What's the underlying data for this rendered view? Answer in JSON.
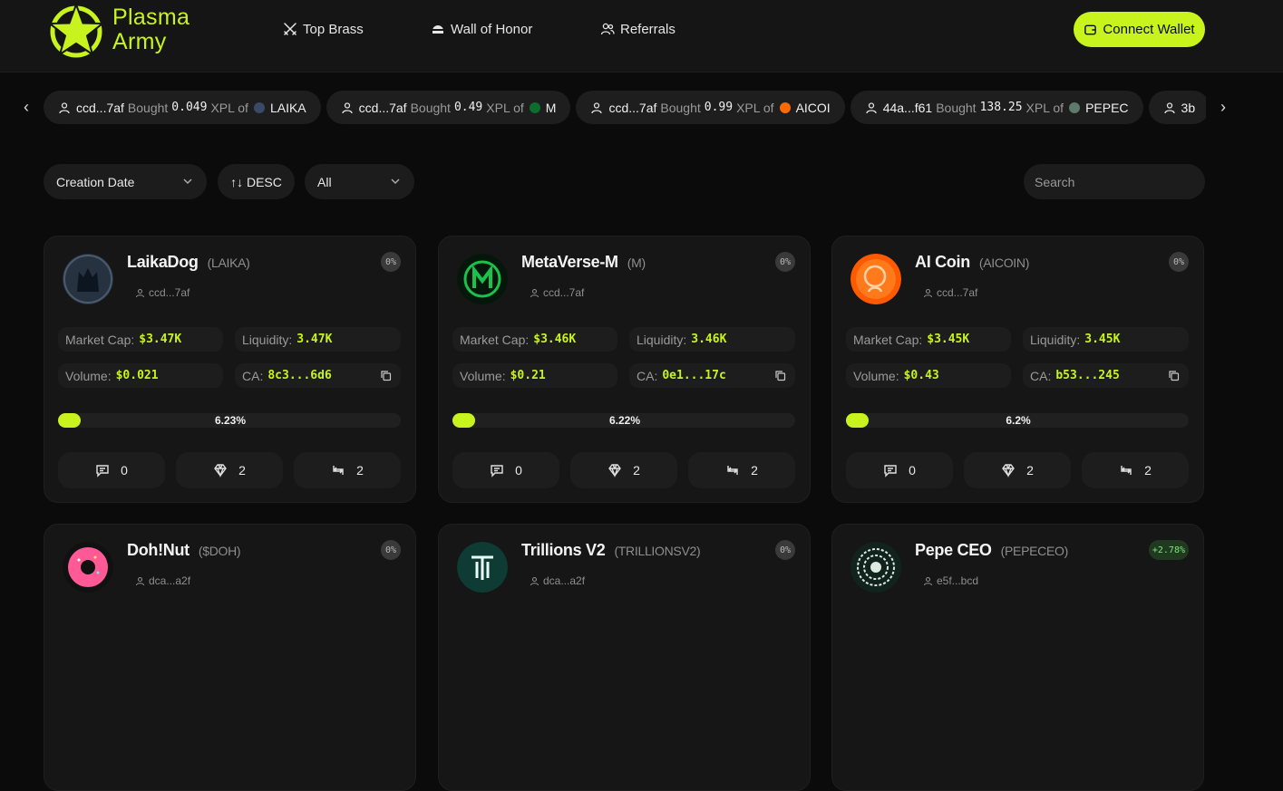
{
  "brand": {
    "line1": "Plasma",
    "line2": "Army",
    "accent": "#c8f31d"
  },
  "nav": [
    {
      "label": "Top Brass",
      "icon": "crossed-swords-icon"
    },
    {
      "label": "Wall of Honor",
      "icon": "helmet-icon"
    },
    {
      "label": "Referrals",
      "icon": "users-icon"
    }
  ],
  "connect_label": "Connect Wallet",
  "ticker": [
    {
      "address": "ccd...7af",
      "verb": "Bought",
      "amount": "0.049",
      "unit": "XPL of",
      "token": "LAIKA",
      "coin_color": "#3a4a66"
    },
    {
      "address": "ccd...7af",
      "verb": "Bought",
      "amount": "0.49",
      "unit": "XPL of",
      "token": "M",
      "coin_color": "#0c6e2c"
    },
    {
      "address": "ccd...7af",
      "verb": "Bought",
      "amount": "0.99",
      "unit": "XPL of",
      "token": "AICOI",
      "coin_color": "#ff6a00"
    },
    {
      "address": "44a...f61",
      "verb": "Bought",
      "amount": "138.25",
      "unit": "XPL of",
      "token": "PEPEC",
      "coin_color": "#5e7a6a"
    },
    {
      "address": "3b",
      "verb": "",
      "amount": "",
      "unit": "",
      "token": "",
      "coin_color": "#333333"
    }
  ],
  "filters": {
    "sort": "Creation Date",
    "order": "↑↓ DESC",
    "scope": "All",
    "search_placeholder": "Search"
  },
  "labels": {
    "market_cap": "Market Cap:",
    "liquidity": "Liquidity:",
    "volume": "Volume:",
    "ca": "CA:"
  },
  "cards": [
    {
      "name": "LaikaDog",
      "symbol": "(LAIKA)",
      "creator": "ccd...7af",
      "badge": "0%",
      "market_cap": "$3.47K",
      "liquidity": "3.47K",
      "volume": "$0.021",
      "ca": "8c3...6d6",
      "progress_label": "6.23%",
      "progress": 6.23,
      "replies": "0",
      "holders": "2",
      "trades": "2"
    },
    {
      "name": "MetaVerse-M",
      "symbol": "(M)",
      "creator": "ccd...7af",
      "badge": "0%",
      "market_cap": "$3.46K",
      "liquidity": "3.46K",
      "volume": "$0.21",
      "ca": "0e1...17c",
      "progress_label": "6.22%",
      "progress": 6.22,
      "replies": "0",
      "holders": "2",
      "trades": "2"
    },
    {
      "name": "AI Coin",
      "symbol": "(AICOIN)",
      "creator": "ccd...7af",
      "badge": "0%",
      "market_cap": "$3.45K",
      "liquidity": "3.45K",
      "volume": "$0.43",
      "ca": "b53...245",
      "progress_label": "6.2%",
      "progress": 6.2,
      "replies": "0",
      "holders": "2",
      "trades": "2"
    },
    {
      "name": "Doh!Nut",
      "symbol": "($DOH)",
      "creator": "dca...a2f",
      "badge": "0%"
    },
    {
      "name": "Trillions V2",
      "symbol": "(TRILLIONSV2)",
      "creator": "dca...a2f",
      "badge": "0%"
    },
    {
      "name": "Pepe CEO",
      "symbol": "(PEPECEO)",
      "creator": "e5f...bcd",
      "badge": "+2.78%"
    }
  ]
}
